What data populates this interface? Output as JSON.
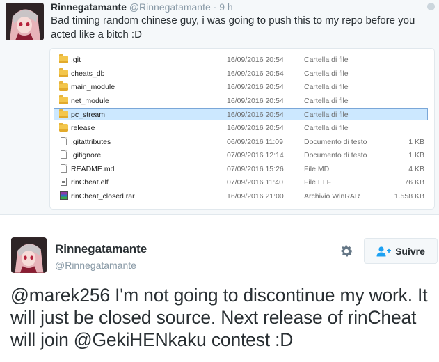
{
  "tweet1": {
    "author_name": "Rinnegatamante",
    "author_handle": "@Rinnegatamante",
    "separator": "·",
    "time": "9 h",
    "text": "Bad timing random chinese guy, i was going to push this to my repo before you acted like a bitch :D",
    "avatar_icon": "anime-avatar-icon",
    "explorer": {
      "selected_index": 4,
      "files": [
        {
          "name": ".git",
          "date": "16/09/2016 20:54",
          "type": "Cartella di file",
          "size": "",
          "icon": "folder-icon"
        },
        {
          "name": "cheats_db",
          "date": "16/09/2016 20:54",
          "type": "Cartella di file",
          "size": "",
          "icon": "folder-icon"
        },
        {
          "name": "main_module",
          "date": "16/09/2016 20:54",
          "type": "Cartella di file",
          "size": "",
          "icon": "folder-icon"
        },
        {
          "name": "net_module",
          "date": "16/09/2016 20:54",
          "type": "Cartella di file",
          "size": "",
          "icon": "folder-icon"
        },
        {
          "name": "pc_stream",
          "date": "16/09/2016 20:54",
          "type": "Cartella di file",
          "size": "",
          "icon": "folder-icon"
        },
        {
          "name": "release",
          "date": "16/09/2016 20:54",
          "type": "Cartella di file",
          "size": "",
          "icon": "folder-icon"
        },
        {
          "name": ".gitattributes",
          "date": "06/09/2016 11:09",
          "type": "Documento di testo",
          "size": "1 KB",
          "icon": "text-file-icon"
        },
        {
          "name": ".gitignore",
          "date": "07/09/2016 12:14",
          "type": "Documento di testo",
          "size": "1 KB",
          "icon": "text-file-icon"
        },
        {
          "name": "README.md",
          "date": "07/09/2016 15:26",
          "type": "File MD",
          "size": "4 KB",
          "icon": "text-file-icon"
        },
        {
          "name": "rinCheat.elf",
          "date": "07/09/2016 11:40",
          "type": "File ELF",
          "size": "76 KB",
          "icon": "binary-file-icon"
        },
        {
          "name": "rinCheat_closed.rar",
          "date": "16/09/2016 21:00",
          "type": "Archivio WinRAR",
          "size": "1.558 KB",
          "icon": "winrar-archive-icon"
        }
      ]
    }
  },
  "tweet2": {
    "author_name": "Rinnegatamante",
    "author_handle": "@Rinnegatamante",
    "follow_label": "Suivre",
    "text_parts": [
      {
        "text": "@marek256",
        "mention": true
      },
      {
        "text": " I'm not going to discontinue my work. It will just be closed source. Next release of rinCheat will join ",
        "mention": false
      },
      {
        "text": "@GekiHENkaku",
        "mention": true
      },
      {
        "text": " contest :D",
        "mention": false
      }
    ]
  },
  "colors": {
    "tweet_bg": "#f5f8fa",
    "text": "#292f33",
    "muted": "#8899a6",
    "selection": "#cce8ff",
    "folder": "#f3c64c",
    "follow_icon": "#1da1f2"
  }
}
